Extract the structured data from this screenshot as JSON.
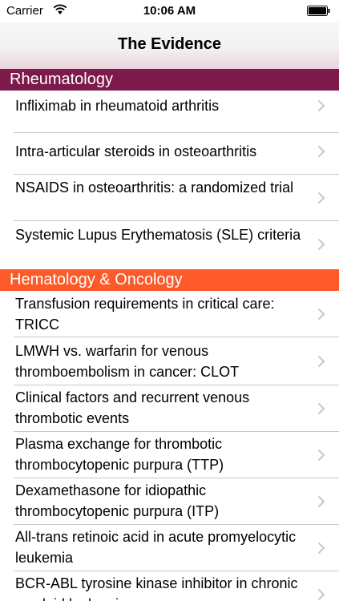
{
  "status_bar": {
    "carrier": "Carrier",
    "time": "10:06 AM"
  },
  "nav": {
    "title": "The Evidence"
  },
  "colors": {
    "rheumatology_header": "#7b1a4b",
    "hematology_header": "#fd5a2a",
    "chevron": "#c7c7cc"
  },
  "sections": [
    {
      "title": "Rheumatology",
      "items": [
        "Infliximab in rheumatoid arthritis",
        "Intra-articular steroids in osteoarthritis",
        "NSAIDS in osteoarthritis: a randomized trial",
        "Systemic Lupus Erythematosis (SLE) criteria"
      ]
    },
    {
      "title": "Hematology & Oncology",
      "items": [
        "Transfusion requirements in critical care: TRICC",
        "LMWH vs. warfarin for venous thromboembolism in cancer: CLOT",
        "Clinical factors and recurrent venous thrombotic events",
        "Plasma exchange for thrombotic thrombocytopenic purpura (TTP)",
        "Dexamethasone for idiopathic thrombocytopenic purpura (ITP)",
        "All-trans retinoic acid in acute promyelocytic leukemia",
        "BCR-ABL tyrosine kinase inhibitor in chronic myeloid leukemia"
      ]
    }
  ],
  "icons": {
    "wifi": "wifi-icon",
    "battery": "battery-icon",
    "chevron": "chevron-right-icon"
  }
}
